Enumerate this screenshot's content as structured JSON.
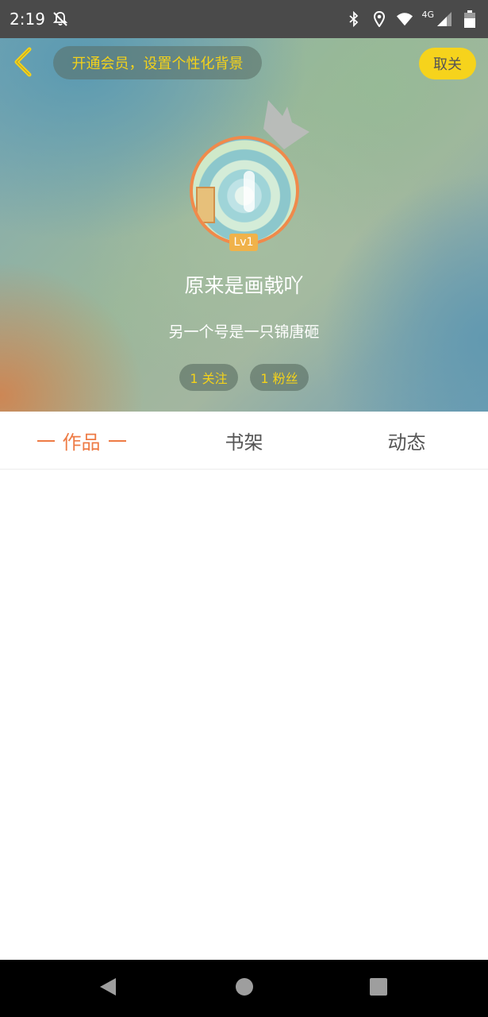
{
  "status_bar": {
    "time": "2:19",
    "network": "4G",
    "icons": [
      "notifications-off-icon",
      "bluetooth-icon",
      "location-icon",
      "wifi-icon",
      "signal-icon",
      "battery-icon"
    ]
  },
  "header": {
    "back_icon": "chevron-left-icon",
    "vip_prompt": "开通会员，设置个性化背景",
    "unfollow_label": "取关",
    "level": "Lv1",
    "username": "原来是画戟吖",
    "bio": "另一个号是一只锦唐砸",
    "following": "1 关注",
    "fans": "1 粉丝"
  },
  "tabs": [
    {
      "label": "作品",
      "active": true
    },
    {
      "label": "书架",
      "active": false
    },
    {
      "label": "动态",
      "active": false
    }
  ],
  "nav_bar": {
    "icons": [
      "back-triangle-icon",
      "home-circle-icon",
      "recents-square-icon"
    ]
  },
  "colors": {
    "accent_yellow": "#f6d31c",
    "accent_orange": "#ee7b45",
    "status_bar": "#4a4a4a",
    "nav_bar": "#000000"
  }
}
